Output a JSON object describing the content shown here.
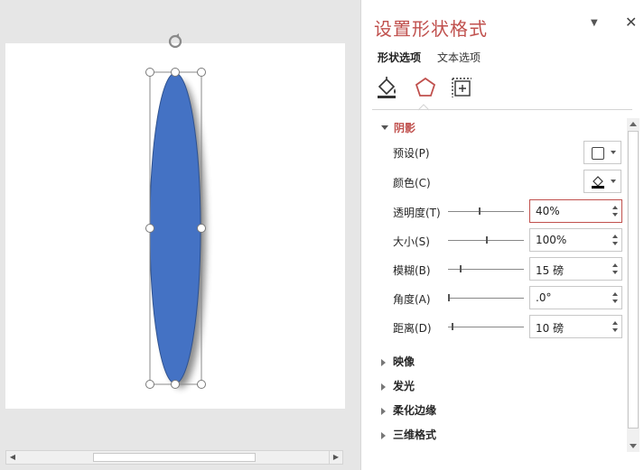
{
  "panel": {
    "title": "设置形状格式",
    "menu_icon": "chevron-down-icon",
    "close_icon": "close-icon",
    "close_glyph": "✕",
    "menu_glyph": "▼",
    "tabs": [
      {
        "label": "形状选项",
        "active": true
      },
      {
        "label": "文本选项",
        "active": false
      }
    ],
    "category_icons": [
      "fill-line-icon",
      "effects-pentagon-icon",
      "size-properties-icon"
    ],
    "accent_color": "#c0504d"
  },
  "shadow": {
    "header": "阴影",
    "preset_label": "预设(P)",
    "color_label": "颜色(C)",
    "transparency": {
      "label": "透明度(T)",
      "value": "40%",
      "level": 0.4
    },
    "size": {
      "label": "大小(S)",
      "value": "100%",
      "level": 0.5
    },
    "blur": {
      "label": "模糊(B)",
      "value": "15 磅",
      "level": 0.15
    },
    "angle": {
      "label": "角度(A)",
      "value": ".0°",
      "level": 0.0
    },
    "distance": {
      "label": "距离(D)",
      "value": "10 磅",
      "level": 0.05
    }
  },
  "sections": [
    "映像",
    "发光",
    "柔化边缘",
    "三维格式"
  ],
  "canvas": {
    "shape_fill": "#4472c4",
    "shape_name": "ellipse-shape",
    "rotate_icon": "rotate-handle-icon"
  }
}
